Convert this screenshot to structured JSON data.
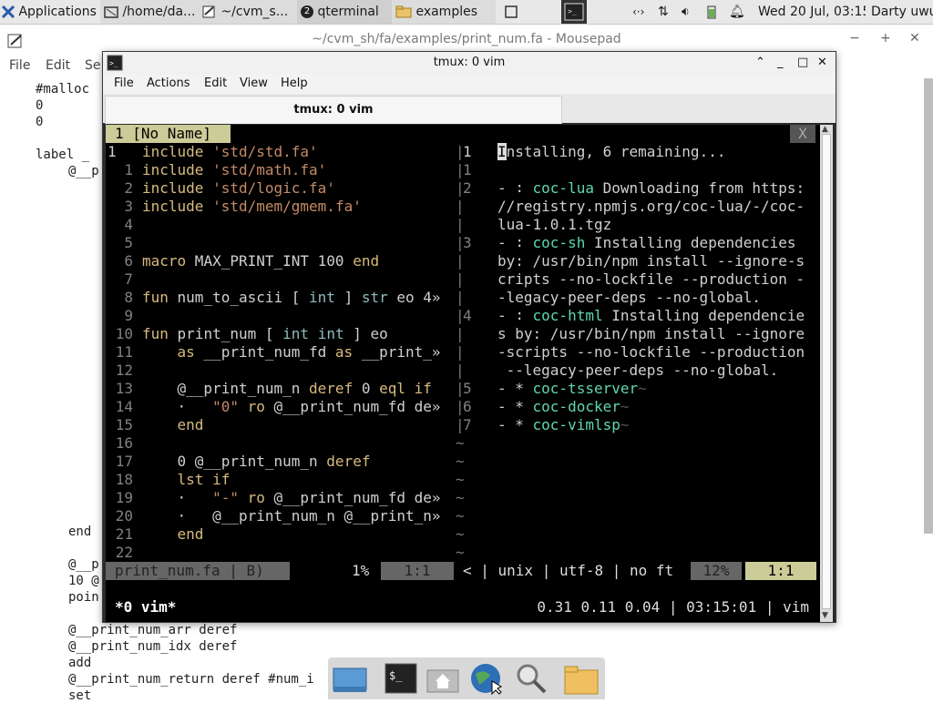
{
  "taskbar": {
    "applications_label": "Applications",
    "tasks": [
      "/home/da...",
      "~/cvm_s...",
      "qterminal",
      "examples"
    ],
    "qterminal_count": "2",
    "clock": "Wed 20 Jul, 03:15",
    "user": "Darty uwu"
  },
  "mousepad": {
    "title": "~/cvm_sh/fa/examples/print_num.fa - Mousepad",
    "menu": [
      "File",
      "Edit",
      "Se"
    ],
    "lines": [
      "#malloc",
      "0",
      "0",
      "label _",
      "@__p",
      "end",
      "@__p",
      "10 @",
      "poin",
      "@__print_num_arr deref",
      "@__print_num_idx deref",
      "add",
      "@__print_num_return deref #num_i",
      "set"
    ]
  },
  "qterminal": {
    "title": "tmux: 0 vim",
    "menu": [
      "File",
      "Actions",
      "Edit",
      "View",
      "Help"
    ],
    "tab": "tmux: 0 vim"
  },
  "vim": {
    "tab_label": "1 [No Name]",
    "close_label": "X",
    "left_numbers": [
      "1",
      "1",
      "2",
      "3",
      "4",
      "5",
      "6",
      "7",
      "8",
      "9",
      "10",
      "11",
      "12",
      "13",
      "14",
      "15",
      "16",
      "17",
      "18",
      "19",
      "20",
      "21",
      "22"
    ],
    "left_lines": [
      "include 'std/std.fa'",
      "include 'std/math.fa'",
      "include 'std/logic.fa'",
      "include 'std/mem/gmem.fa'",
      "",
      "",
      "macro MAX_PRINT_INT 100 end",
      "",
      "fun num_to_ascii [ int ] str eo 4»",
      "",
      "fun print_num [ int int ] eo",
      "    as __print_num_fd as __print_»",
      "",
      "    @__print_num_n deref 0 eql if",
      "    ·   \"0\" ro @__print_num_fd de»",
      "    end",
      "",
      "    0 @__print_num_n deref",
      "    lst if",
      "    ·   \"-\" ro @__print_num_fd de»",
      "    ·   @__print_num_n @__print_n»",
      "    end",
      ""
    ],
    "right_numbers": [
      "1",
      "1",
      "2",
      "",
      "",
      "3",
      "",
      "",
      "4",
      "",
      "",
      "",
      "5",
      "6",
      "7"
    ],
    "right_lines": [
      "Installing, 6 remaining...",
      "",
      "- ∶ coc-lua Downloading from https:",
      "//registry.npmjs.org/coc-lua/-/coc-",
      "lua-1.0.1.tgz",
      "- ∶ coc-sh Installing dependencies",
      "by: /usr/bin/npm install --ignore-s",
      "cripts --no-lockfile --production -",
      "-legacy-peer-deps --no-global.",
      "- ∶ coc-html Installing dependencie",
      "s by: /usr/bin/npm install --ignore",
      "-scripts --no-lockfile --production",
      " --legacy-peer-deps --no-global.",
      "- * coc-tsserver~",
      "- * coc-docker~",
      "- * coc-vimlsp~"
    ],
    "status_left": "print_num.fa | B)",
    "status_pct": "1%",
    "status_pos": "1:1",
    "status_mid": "< | unix | utf-8 | no ft",
    "status_pct2": "12%",
    "status_pos2": "1:1",
    "tmux_left": "*0 vim*",
    "tmux_right": "0.31 0.11 0.04 | 03:15:01 | vim"
  },
  "colors": {
    "vim_keyword": "#d7ba7d",
    "vim_string": "#c48a66",
    "vim_type": "#8fbcbb",
    "vim_linenr": "#808080",
    "coc_name": "#5fd7af",
    "status_bg": "#cccc99"
  }
}
